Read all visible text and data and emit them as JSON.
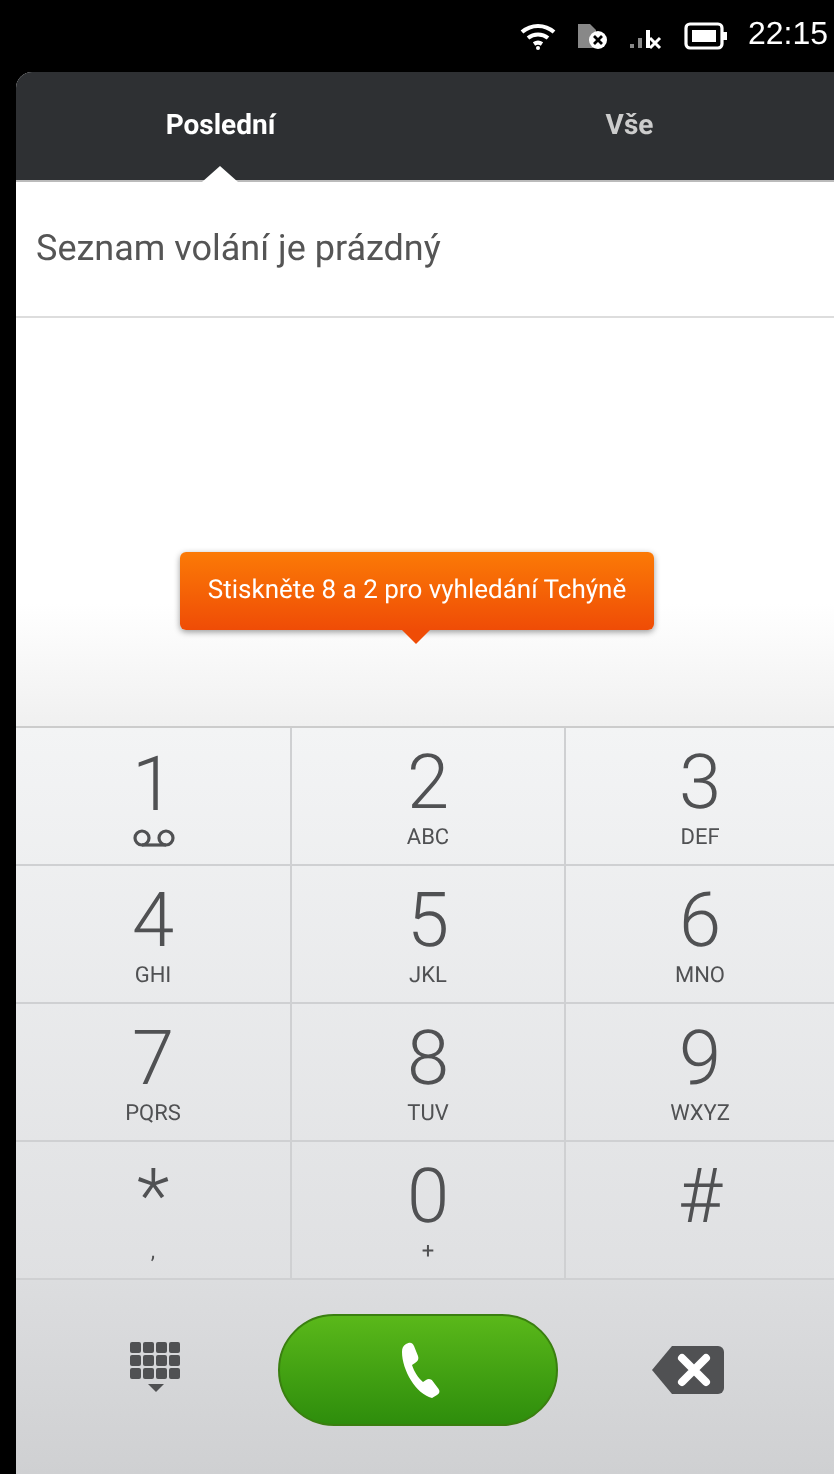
{
  "status_bar": {
    "time": "22:15"
  },
  "tabs": [
    {
      "label": "Poslední",
      "selected": true
    },
    {
      "label": "Vše",
      "selected": false
    }
  ],
  "empty_message": "Seznam volání je prázdný",
  "tooltip": "Stiskněte 8 a 2 pro vyhledání Tchýně",
  "keys": [
    {
      "digit": "1",
      "kind": "voicemail"
    },
    {
      "digit": "2",
      "kind": "letters",
      "sub": "ABC"
    },
    {
      "digit": "3",
      "kind": "letters",
      "sub": "DEF"
    },
    {
      "digit": "4",
      "kind": "letters",
      "sub": "GHI"
    },
    {
      "digit": "5",
      "kind": "letters",
      "sub": "JKL"
    },
    {
      "digit": "6",
      "kind": "letters",
      "sub": "MNO"
    },
    {
      "digit": "7",
      "kind": "letters",
      "sub": "PQRS"
    },
    {
      "digit": "8",
      "kind": "letters",
      "sub": "TUV"
    },
    {
      "digit": "9",
      "kind": "letters",
      "sub": "WXYZ"
    },
    {
      "digit": "*",
      "kind": "letters",
      "sub": ","
    },
    {
      "digit": "0",
      "kind": "letters",
      "sub": "+"
    },
    {
      "digit": "#",
      "kind": "letters"
    }
  ]
}
